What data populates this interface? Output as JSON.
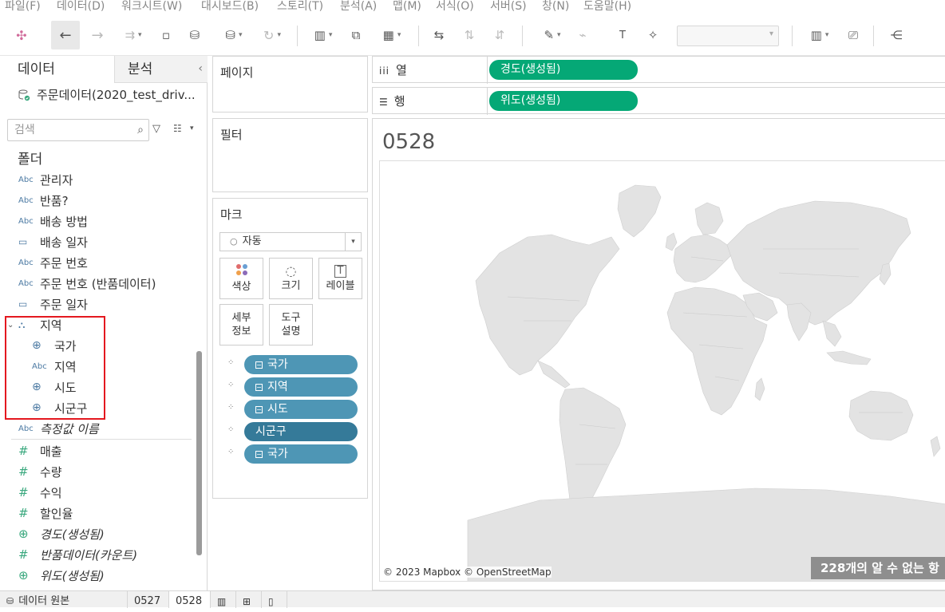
{
  "menu": [
    "파일(F)",
    "데이터(D)",
    "워크시트(W)",
    "대시보드(B)",
    "스토리(T)",
    "분석(A)",
    "맵(M)",
    "서식(O)",
    "서버(S)",
    "창(N)",
    "도움말(H)"
  ],
  "data_pane": {
    "tab_data": "데이터",
    "tab_analysis": "분석",
    "datasource_name": "주문데이터(2020_test_driv...",
    "search_placeholder": "검색",
    "folder_title": "폴더",
    "fields": [
      {
        "icon": "Abc",
        "name": "관리자"
      },
      {
        "icon": "Abc",
        "name": "반품?"
      },
      {
        "icon": "Abc",
        "name": "배송 방법"
      },
      {
        "icon": "calendar",
        "name": "배송 일자"
      },
      {
        "icon": "Abc",
        "name": "주문 번호"
      },
      {
        "icon": "Abc",
        "name": "주문 번호 (반품데이터)"
      },
      {
        "icon": "calendar",
        "name": "주문 일자"
      },
      {
        "icon": "hierarchy",
        "name": "지역"
      },
      {
        "icon": "globe",
        "name": "국가"
      },
      {
        "icon": "Abc",
        "name": "지역"
      },
      {
        "icon": "globe",
        "name": "시도"
      },
      {
        "icon": "globe",
        "name": "시군구"
      },
      {
        "icon": "Abc",
        "name": "측정값 이름"
      },
      {
        "icon": "#",
        "name": "매출"
      },
      {
        "icon": "#",
        "name": "수량"
      },
      {
        "icon": "#",
        "name": "수익"
      },
      {
        "icon": "#",
        "name": "할인율"
      },
      {
        "icon": "globe-green",
        "name": "경도(생성됨)"
      },
      {
        "icon": "#",
        "name": "반품데이터(카운트)"
      },
      {
        "icon": "globe-green",
        "name": "위도(생성됨)"
      }
    ]
  },
  "shelves": {
    "pages": "페이지",
    "filters": "필터",
    "marks": "마크",
    "mark_type": "자동",
    "mark_buttons": [
      "색상",
      "크기",
      "레이블",
      "세부\n정보",
      "도구\n설명"
    ],
    "mark_pills": [
      "국가",
      "지역",
      "시도",
      "시군구",
      "국가"
    ],
    "columns_label": "열",
    "rows_label": "행",
    "columns_pill": "경도(생성됨)",
    "rows_pill": "위도(생성됨)"
  },
  "viz": {
    "title": "0528",
    "attribution": "© 2023 Mapbox © OpenStreetMap",
    "unknown_indicator": "228개의 알 수 없는 항"
  },
  "bottom_tabs": [
    "데이터 원본",
    "0527",
    "0528"
  ],
  "colors": {
    "green_pill": "#05a876",
    "blue_pill": "#4e96b5",
    "dark_blue_pill": "#357a99",
    "highlight_box": "#e4181f"
  }
}
